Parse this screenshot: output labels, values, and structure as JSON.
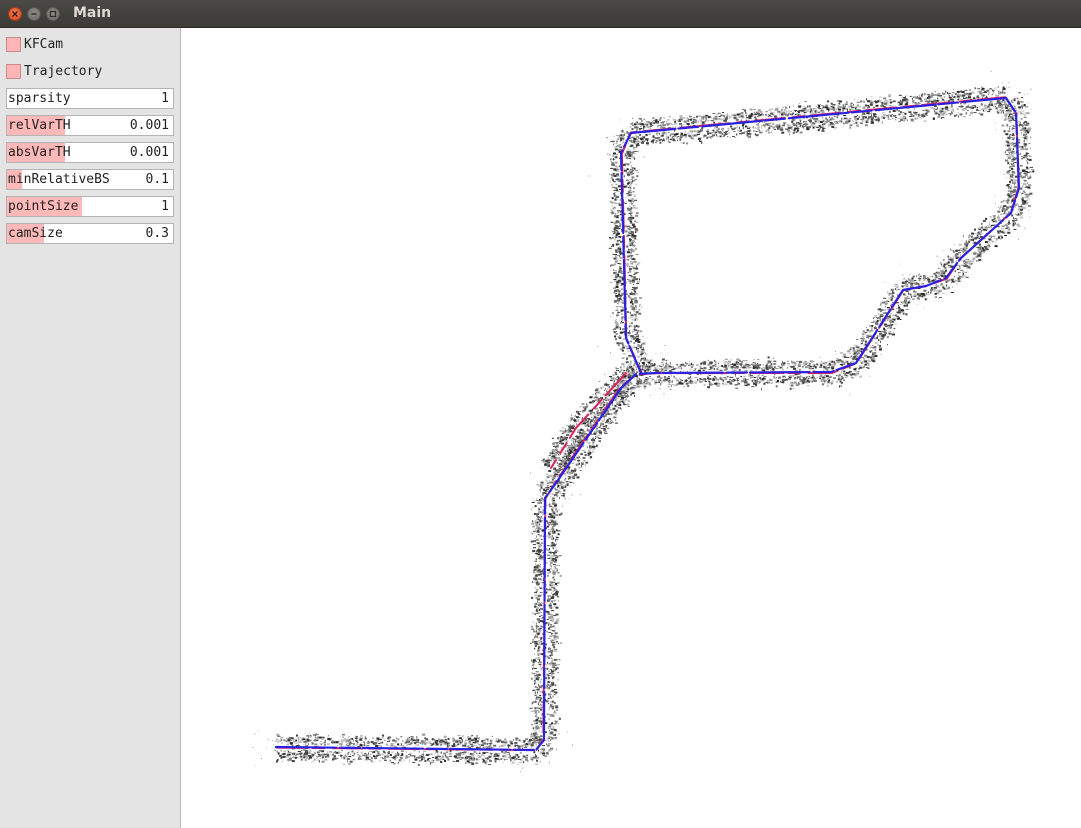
{
  "window": {
    "title": "Main",
    "controls": [
      "close",
      "minimize",
      "maximize"
    ]
  },
  "panel": {
    "checkboxes": [
      {
        "label": "KFCam",
        "checked": true
      },
      {
        "label": "Trajectory",
        "checked": true
      }
    ],
    "sliders": [
      {
        "label": "sparsity",
        "value": "1",
        "fill_fraction": 0.0
      },
      {
        "label": "relVarTH",
        "value": "0.001",
        "fill_fraction": 0.35
      },
      {
        "label": "absVarTH",
        "value": "0.001",
        "fill_fraction": 0.35
      },
      {
        "label": "minRelativeBS",
        "value": "0.1",
        "fill_fraction": 0.09
      },
      {
        "label": "pointSize",
        "value": "1",
        "fill_fraction": 0.45
      },
      {
        "label": "camSize",
        "value": "0.3",
        "fill_fraction": 0.22
      }
    ]
  },
  "colors": {
    "checkbox_fill": "#ffb5b5",
    "slider_fill": "#ffb9b9",
    "trajectory_blue": "#2a22e0",
    "trajectory_red": "#e0205a",
    "point_cloud": "#3a3a3a"
  }
}
